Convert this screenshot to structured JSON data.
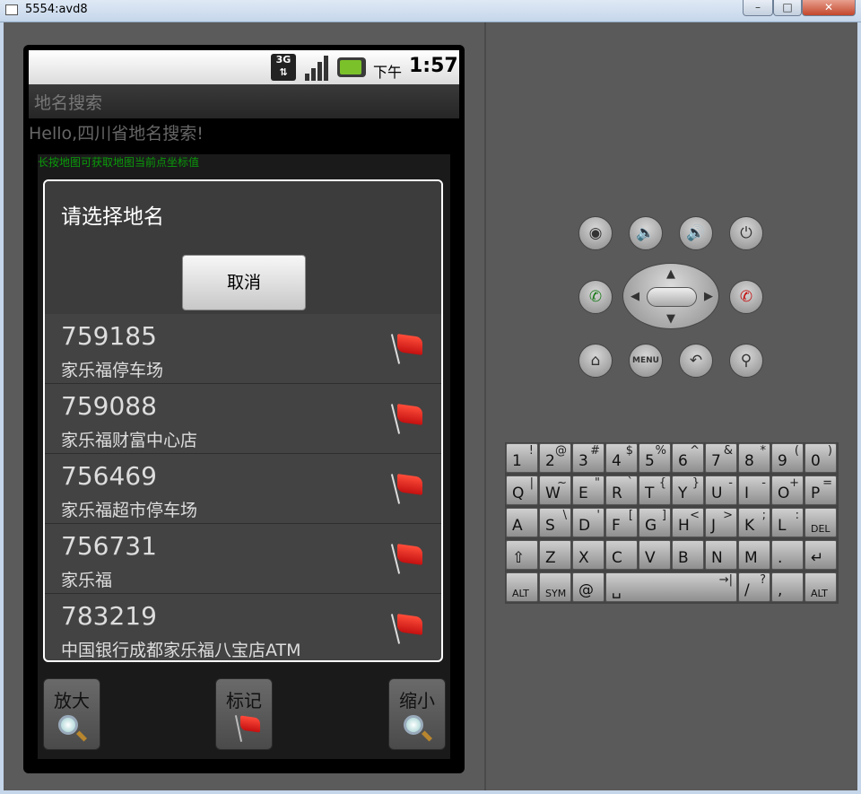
{
  "window": {
    "title": "5554:avd8"
  },
  "status_bar": {
    "network": "3G",
    "ampm": "下午",
    "time": "1:57"
  },
  "app": {
    "title": "地名搜索",
    "hello": "Hello,四川省地名搜索!",
    "map_hint": "长按地图可获取地图当前点坐标值"
  },
  "dialog": {
    "title": "请选择地名",
    "cancel_label": "取消",
    "items": [
      {
        "id": "759185",
        "name": "家乐福停车场"
      },
      {
        "id": "759088",
        "name": "家乐福财富中心店"
      },
      {
        "id": "756469",
        "name": "家乐福超市停车场"
      },
      {
        "id": "756731",
        "name": "家乐福"
      },
      {
        "id": "783219",
        "name": "中国银行成都家乐福八宝店ATM"
      }
    ]
  },
  "bottom_buttons": {
    "zoom_in": "放大",
    "mark": "标记",
    "zoom_out": "缩小"
  },
  "controls": {
    "menu_label": "MENU"
  },
  "keyboard": {
    "rows": [
      [
        [
          "1",
          "!"
        ],
        [
          "2",
          "@"
        ],
        [
          "3",
          "#"
        ],
        [
          "4",
          "$"
        ],
        [
          "5",
          "%"
        ],
        [
          "6",
          "^"
        ],
        [
          "7",
          "&"
        ],
        [
          "8",
          "*"
        ],
        [
          "9",
          "("
        ],
        [
          "0",
          ")"
        ]
      ],
      [
        [
          "Q",
          "|"
        ],
        [
          "W",
          "~"
        ],
        [
          "E",
          "\""
        ],
        [
          "R",
          "`"
        ],
        [
          "T",
          "{"
        ],
        [
          "Y",
          "}"
        ],
        [
          "U",
          "-"
        ],
        [
          "I",
          "-"
        ],
        [
          "O",
          "+"
        ],
        [
          "P",
          "="
        ]
      ],
      [
        [
          "A",
          ""
        ],
        [
          "S",
          "\\"
        ],
        [
          "D",
          "'"
        ],
        [
          "F",
          "["
        ],
        [
          "G",
          "]"
        ],
        [
          "H",
          "<"
        ],
        [
          "J",
          ">"
        ],
        [
          "K",
          ";"
        ],
        [
          "L",
          ":"
        ],
        [
          "DEL",
          ""
        ]
      ],
      [
        [
          "⇧",
          ""
        ],
        [
          "Z",
          ""
        ],
        [
          "X",
          ""
        ],
        [
          "C",
          ""
        ],
        [
          "V",
          ""
        ],
        [
          "B",
          ""
        ],
        [
          "N",
          ""
        ],
        [
          "M",
          ""
        ],
        [
          ".",
          ""
        ],
        [
          "↵",
          ""
        ]
      ],
      [
        [
          "ALT",
          ""
        ],
        [
          "SYM",
          ""
        ],
        [
          "@",
          ""
        ],
        [
          "␣",
          "→|"
        ],
        [
          "/",
          "?"
        ],
        [
          ",",
          ""
        ],
        [
          "ALT",
          ""
        ]
      ]
    ]
  }
}
